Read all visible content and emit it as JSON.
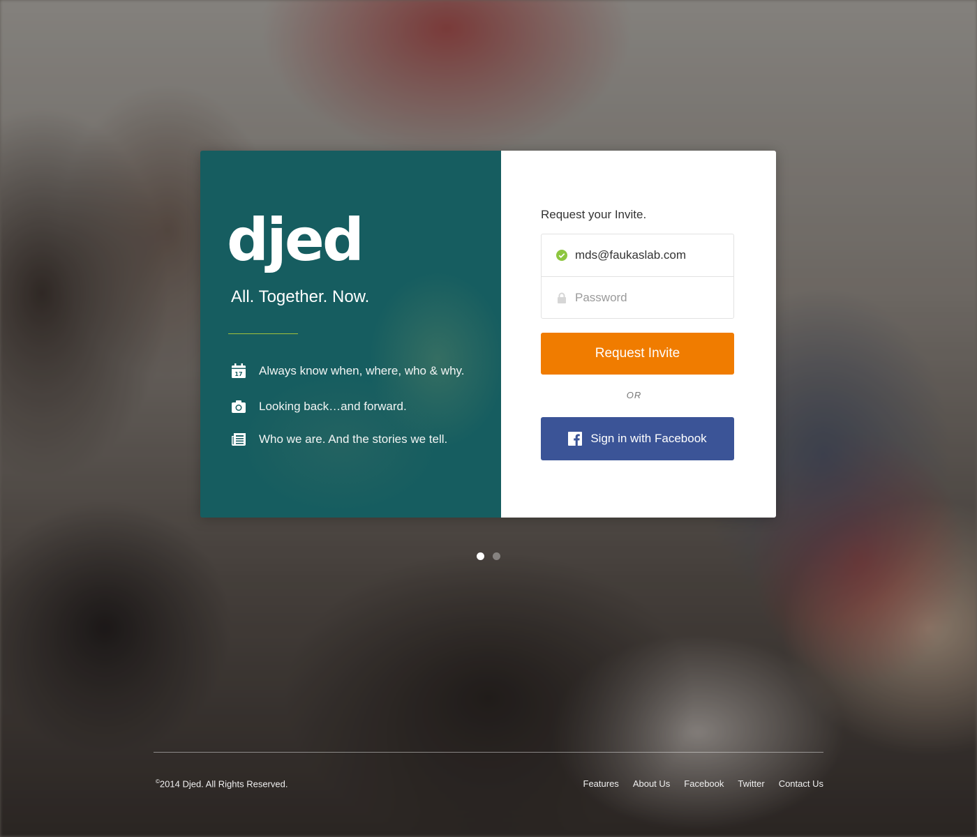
{
  "brand": {
    "logo_text": "djed",
    "tagline": "All. Together. Now."
  },
  "features": [
    {
      "icon": "calendar-icon",
      "text": "Always know when, where, who & why."
    },
    {
      "icon": "camera-icon",
      "text": "Looking back…and forward."
    },
    {
      "icon": "newspaper-icon",
      "text": "Who we are. And the stories we tell."
    }
  ],
  "form": {
    "title": "Request your Invite.",
    "email_value": "mds@faukaslab.com",
    "password_placeholder": "Password",
    "submit_label": "Request Invite",
    "or_label": "OR",
    "facebook_label": "Sign in with Facebook"
  },
  "footer": {
    "copyright_mark": "©",
    "copyright_text": "2014 Djed. All Rights Reserved.",
    "links": [
      "Features",
      "About Us",
      "Facebook",
      "Twitter",
      "Contact Us"
    ]
  },
  "colors": {
    "panel_teal": "#165d60",
    "accent_green": "#a3c23c",
    "invite_orange": "#f07c00",
    "facebook_blue": "#3b5497"
  },
  "carousel": {
    "total": 2,
    "active_index": 0
  }
}
